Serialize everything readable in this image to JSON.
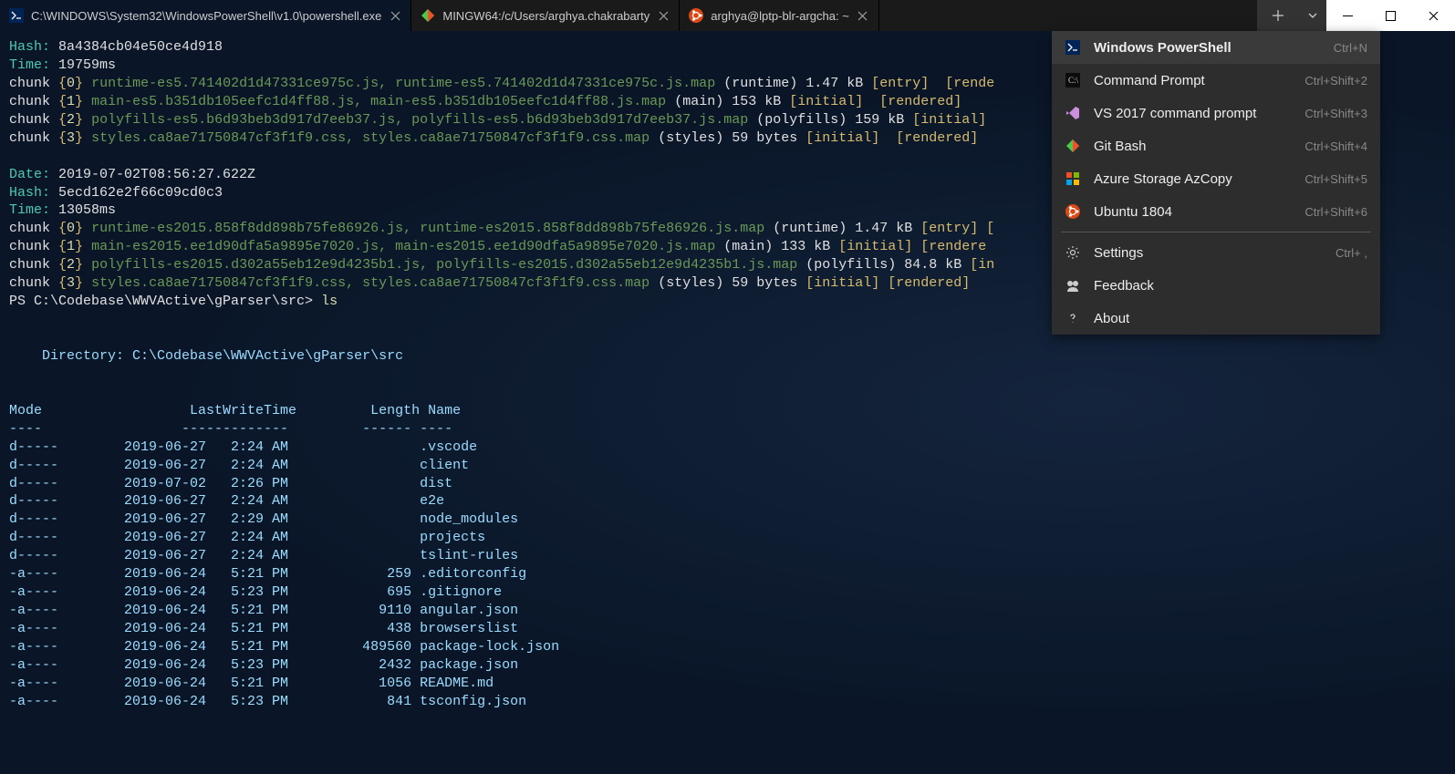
{
  "tabs": [
    {
      "icon": "ps",
      "title": "C:\\WINDOWS\\System32\\WindowsPowerShell\\v1.0\\powershell.exe",
      "active": true
    },
    {
      "icon": "git",
      "title": "MINGW64:/c/Users/arghya.chakrabarty",
      "active": false
    },
    {
      "icon": "ubuntu",
      "title": "arghya@lptp-blr-argcha: ~",
      "active": false
    }
  ],
  "build": {
    "hash1": "8a4384cb04e50ce4d918",
    "time1": "19759ms",
    "chunks1": [
      {
        "idx": "0",
        "files": "runtime-es5.741402d1d47331ce975c.js, runtime-es5.741402d1d47331ce975c.js.map",
        "name": "(runtime)",
        "size": "1.47 kB",
        "flags": "[entry] [rende"
      },
      {
        "idx": "1",
        "files": "main-es5.b351db105eefc1d4ff88.js, main-es5.b351db105eefc1d4ff88.js.map",
        "name": "(main)",
        "size": "153 kB",
        "flags": "[initial] [rendered]"
      },
      {
        "idx": "2",
        "files": "polyfills-es5.b6d93beb3d917d7eeb37.js, polyfills-es5.b6d93beb3d917d7eeb37.js.map",
        "name": "(polyfills)",
        "size": "159 kB",
        "flags": "[initial]"
      },
      {
        "idx": "3",
        "files": "styles.ca8ae71750847cf3f1f9.css, styles.ca8ae71750847cf3f1f9.css.map",
        "name": "(styles)",
        "size": "59 bytes",
        "flags": "[initial] [rendered]"
      }
    ],
    "date2": "2019-07-02T08:56:27.622Z",
    "hash2": "5ecd162e2f66c09cd0c3",
    "time2": "13058ms",
    "chunks2": [
      {
        "idx": "0",
        "files": "runtime-es2015.858f8dd898b75fe86926.js, runtime-es2015.858f8dd898b75fe86926.js.map",
        "name": "(runtime)",
        "size": "1.47 kB",
        "flags": "[entry] ["
      },
      {
        "idx": "1",
        "files": "main-es2015.ee1d90dfa5a9895e7020.js, main-es2015.ee1d90dfa5a9895e7020.js.map",
        "name": "(main)",
        "size": "133 kB",
        "flags": "[initial] [rendere"
      },
      {
        "idx": "2",
        "files": "polyfills-es2015.d302a55eb12e9d4235b1.js, polyfills-es2015.d302a55eb12e9d4235b1.js.map",
        "name": "(polyfills)",
        "size": "84.8 kB",
        "flags": "[in"
      },
      {
        "idx": "3",
        "files": "styles.ca8ae71750847cf3f1f9.css, styles.ca8ae71750847cf3f1f9.css.map",
        "name": "(styles)",
        "size": "59 bytes",
        "flags": "[initial] [rendered]"
      }
    ]
  },
  "prompt": "PS C:\\Codebase\\WWVActive\\gParser\\src>",
  "command": "ls",
  "dir_label": "Directory:",
  "dir_path": "C:\\Codebase\\WWVActive\\gParser\\src",
  "ls_headers": {
    "mode": "Mode",
    "lwt": "LastWriteTime",
    "len": "Length",
    "name": "Name"
  },
  "ls_rows": [
    {
      "mode": "d-----",
      "date": "2019-06-27",
      "time": "2:24 AM",
      "len": "",
      "name": ".vscode"
    },
    {
      "mode": "d-----",
      "date": "2019-06-27",
      "time": "2:24 AM",
      "len": "",
      "name": "client"
    },
    {
      "mode": "d-----",
      "date": "2019-07-02",
      "time": "2:26 PM",
      "len": "",
      "name": "dist"
    },
    {
      "mode": "d-----",
      "date": "2019-06-27",
      "time": "2:24 AM",
      "len": "",
      "name": "e2e"
    },
    {
      "mode": "d-----",
      "date": "2019-06-27",
      "time": "2:29 AM",
      "len": "",
      "name": "node_modules"
    },
    {
      "mode": "d-----",
      "date": "2019-06-27",
      "time": "2:24 AM",
      "len": "",
      "name": "projects"
    },
    {
      "mode": "d-----",
      "date": "2019-06-27",
      "time": "2:24 AM",
      "len": "",
      "name": "tslint-rules"
    },
    {
      "mode": "-a----",
      "date": "2019-06-24",
      "time": "5:21 PM",
      "len": "259",
      "name": ".editorconfig"
    },
    {
      "mode": "-a----",
      "date": "2019-06-24",
      "time": "5:23 PM",
      "len": "695",
      "name": ".gitignore"
    },
    {
      "mode": "-a----",
      "date": "2019-06-24",
      "time": "5:21 PM",
      "len": "9110",
      "name": "angular.json"
    },
    {
      "mode": "-a----",
      "date": "2019-06-24",
      "time": "5:21 PM",
      "len": "438",
      "name": "browserslist"
    },
    {
      "mode": "-a----",
      "date": "2019-06-24",
      "time": "5:21 PM",
      "len": "489560",
      "name": "package-lock.json"
    },
    {
      "mode": "-a----",
      "date": "2019-06-24",
      "time": "5:23 PM",
      "len": "2432",
      "name": "package.json"
    },
    {
      "mode": "-a----",
      "date": "2019-06-24",
      "time": "5:21 PM",
      "len": "1056",
      "name": "README.md"
    },
    {
      "mode": "-a----",
      "date": "2019-06-24",
      "time": "5:23 PM",
      "len": "841",
      "name": "tsconfig.json"
    }
  ],
  "menu": [
    {
      "icon": "ps",
      "label": "Windows PowerShell",
      "shortcut": "Ctrl+N",
      "active": true
    },
    {
      "icon": "cmd",
      "label": "Command Prompt",
      "shortcut": "Ctrl+Shift+2",
      "active": false
    },
    {
      "icon": "vs",
      "label": "VS 2017 command prompt",
      "shortcut": "Ctrl+Shift+3",
      "active": false
    },
    {
      "icon": "git",
      "label": "Git Bash",
      "shortcut": "Ctrl+Shift+4",
      "active": false
    },
    {
      "icon": "azure",
      "label": "Azure Storage AzCopy",
      "shortcut": "Ctrl+Shift+5",
      "active": false
    },
    {
      "icon": "ubuntu",
      "label": "Ubuntu 1804",
      "shortcut": "Ctrl+Shift+6",
      "active": false
    }
  ],
  "menu_footer": [
    {
      "icon": "settings",
      "label": "Settings",
      "shortcut": "Ctrl+ ,"
    },
    {
      "icon": "feedback",
      "label": "Feedback",
      "shortcut": ""
    },
    {
      "icon": "about",
      "label": "About",
      "shortcut": ""
    }
  ],
  "labels": {
    "hash": "Hash:",
    "time": "Time:",
    "date": "Date:",
    "chunk": "chunk"
  }
}
